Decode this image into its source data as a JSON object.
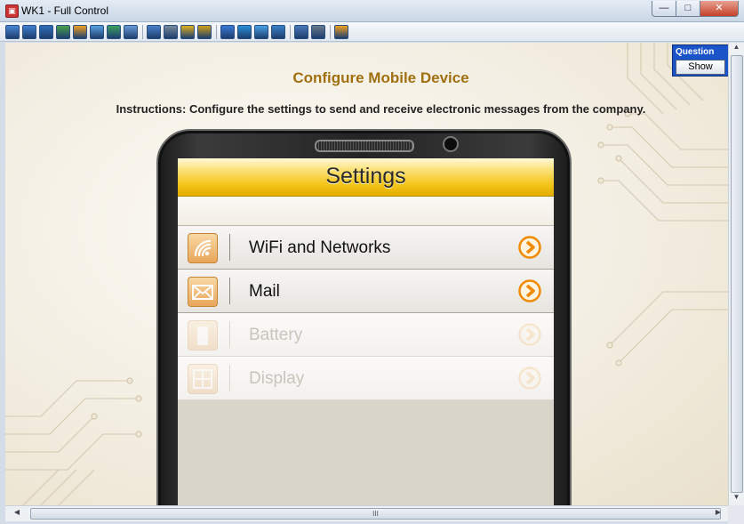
{
  "window": {
    "title": "WK1 - Full Control",
    "app_icon_glyph": "▣",
    "controls": {
      "minimize": "—",
      "maximize": "□",
      "close": "✕"
    }
  },
  "toolbar": {
    "icons": [
      {
        "name": "screen-icon",
        "color": "#4a86d6"
      },
      {
        "name": "monitor-icon",
        "color": "#3f7fd0"
      },
      {
        "name": "console-icon",
        "color": "#2f6db8"
      },
      {
        "name": "transfer-icon",
        "color": "#4aa04a"
      },
      {
        "name": "clock-icon",
        "color": "#f0a020"
      },
      {
        "name": "chat-icon",
        "color": "#5aa0e0"
      },
      {
        "name": "phone-icon",
        "color": "#3aa060"
      },
      {
        "name": "message-icon",
        "color": "#6a9ad8"
      },
      {
        "name": "user-icon",
        "color": "#4a80c8"
      },
      {
        "name": "users-icon",
        "color": "#7a8a9a"
      },
      {
        "name": "lock-icon",
        "color": "#e0b020"
      },
      {
        "name": "lock-alt-icon",
        "color": "#d0a018"
      },
      {
        "name": "fullscreen-icon",
        "color": "#3a78d8"
      },
      {
        "name": "fit-icon",
        "color": "#2a90d8"
      },
      {
        "name": "window-icon",
        "color": "#4aa0e8"
      },
      {
        "name": "scale-icon",
        "color": "#3a80c8"
      },
      {
        "name": "snapshot-icon",
        "color": "#4a7ab8"
      },
      {
        "name": "tools-icon",
        "color": "#6a7a8a"
      },
      {
        "name": "exit-icon",
        "color": "#f0a020"
      }
    ]
  },
  "question": {
    "label": "Question",
    "button": "Show"
  },
  "page": {
    "title": "Configure Mobile Device",
    "instructions": "Instructions: Configure the settings to send and receive electronic messages from the company."
  },
  "phone": {
    "header": "Settings",
    "items": [
      {
        "label": "WiFi and Networks",
        "icon": "wifi-icon",
        "enabled": true
      },
      {
        "label": "Mail",
        "icon": "mail-icon",
        "enabled": true
      },
      {
        "label": "Battery",
        "icon": "battery-icon",
        "enabled": false
      },
      {
        "label": "Display",
        "icon": "display-icon",
        "enabled": false
      }
    ],
    "colors": {
      "accent": "#f4c51a",
      "chevron": "#f08a00"
    }
  },
  "scrollbar": {
    "h_thumb_grip": "III"
  }
}
